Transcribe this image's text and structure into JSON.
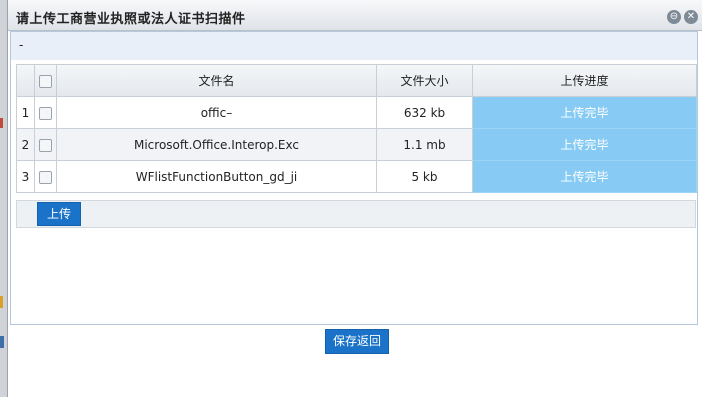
{
  "dialog": {
    "title": "请上传工商营业执照或法人证书扫描件",
    "max_icon": "⊖",
    "close_icon": "✕"
  },
  "toolbar": {
    "dash": "-"
  },
  "grid": {
    "headers": {
      "filename": "文件名",
      "filesize": "文件大小",
      "progress": "上传进度"
    },
    "rows": [
      {
        "num": "1",
        "filename": "offic–",
        "size": "632 kb",
        "status": "上传完毕"
      },
      {
        "num": "2",
        "filename": "Microsoft.Office.Interop.Exc",
        "size": "1.1 mb",
        "status": "上传完毕"
      },
      {
        "num": "3",
        "filename": "WFlistFunctionButton_gd_ji",
        "size": "5 kb",
        "status": "上传完毕"
      }
    ]
  },
  "buttons": {
    "upload": "上传",
    "save_return": "保存返回"
  },
  "colors": {
    "progress": "#87cbf5",
    "button": "#1a73c8"
  }
}
